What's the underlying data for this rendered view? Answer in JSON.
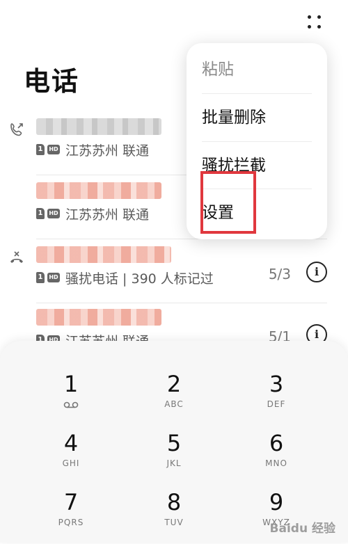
{
  "header": {
    "title": "电话",
    "more_icon": "more-dots-icon"
  },
  "popup_menu": {
    "items": [
      {
        "label": "粘贴",
        "enabled": false
      },
      {
        "label": "批量删除",
        "enabled": true
      },
      {
        "label": "骚扰拦截",
        "enabled": true
      },
      {
        "label": "设置",
        "enabled": true,
        "highlighted": true
      }
    ],
    "highlight_color": "#e0383e"
  },
  "call_log": [
    {
      "type_icon": "outgoing-call-icon",
      "location": "江苏苏州 联通",
      "date": ""
    },
    {
      "type_icon": "",
      "location": "江苏苏州 联通",
      "date": ""
    },
    {
      "type_icon": "missed-call-icon",
      "location": "骚扰电话 | 390 人标记过",
      "date": "5/3"
    },
    {
      "type_icon": "",
      "location": "江苏苏州 联通",
      "date": "5/1"
    }
  ],
  "dialpad": {
    "keys": [
      {
        "digit": "1",
        "letters": ""
      },
      {
        "digit": "2",
        "letters": "ABC"
      },
      {
        "digit": "3",
        "letters": "DEF"
      },
      {
        "digit": "4",
        "letters": "GHI"
      },
      {
        "digit": "5",
        "letters": "JKL"
      },
      {
        "digit": "6",
        "letters": "MNO"
      },
      {
        "digit": "7",
        "letters": "PQRS"
      },
      {
        "digit": "8",
        "letters": "TUV"
      },
      {
        "digit": "9",
        "letters": "WXYZ"
      }
    ]
  },
  "badges": {
    "sim": "1",
    "hd": "HD"
  },
  "watermark": "Baidu 经验"
}
